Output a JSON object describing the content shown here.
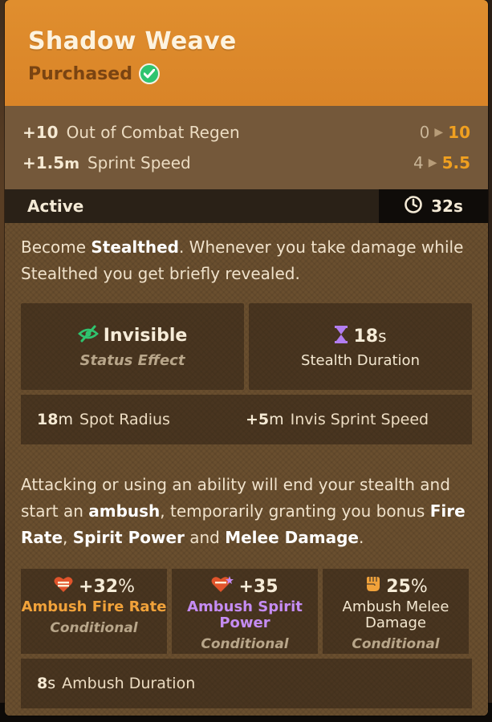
{
  "item": {
    "title": "Shadow Weave",
    "status": "Purchased",
    "accent_color": "#e08e2e"
  },
  "base_stats": [
    {
      "bonus": "+10",
      "unit": "",
      "label": "Out of Combat Regen",
      "from": "0",
      "to": "10"
    },
    {
      "bonus": "+1.5",
      "unit": "m",
      "label": "Sprint Speed",
      "from": "4",
      "to": "5.5"
    }
  ],
  "active": {
    "label": "Active",
    "cooldown": "32s",
    "cooldown_icon": "cooldown-clock-icon"
  },
  "description_1": {
    "p1": "Become ",
    "b1": "Stealthed",
    "p2": ". Whenever you take damage while Stealthed you get briefly revealed."
  },
  "effects": {
    "invisible": {
      "title": "Invisible",
      "sub": "Status Effect",
      "icon": "invisible-eye-icon",
      "color": "#2fc46f"
    },
    "stealth_duration": {
      "value": "18",
      "unit": "s",
      "label": "Stealth Duration",
      "icon": "hourglass-icon",
      "color": "#b27df0"
    },
    "spot_radius": {
      "value": "18",
      "unit": "m",
      "label": "Spot Radius"
    },
    "invis_sprint": {
      "value": "+5",
      "unit": "m",
      "label": "Invis Sprint Speed"
    }
  },
  "description_2": {
    "p1": "Attacking or using an ability will end your stealth and start an ",
    "b1": "ambush",
    "p2": ", temporarily granting you bonus ",
    "b2": "Fire Rate",
    "p3": ", ",
    "b3": "Spirit Power",
    "p4": " and ",
    "b4": "Melee Damage",
    "p5": "."
  },
  "ambush": [
    {
      "value": "+32",
      "unit": "%",
      "name": "Ambush Fire Rate",
      "cond": "Conditional",
      "icon": "fire-rate-icon"
    },
    {
      "value": "+35",
      "unit": "",
      "name": "Ambush Spirit Power",
      "cond": "Conditional",
      "icon": "spirit-power-icon"
    },
    {
      "value": "25",
      "unit": "%",
      "name": "Ambush Melee Damage",
      "cond": "Conditional",
      "icon": "melee-fist-icon"
    }
  ],
  "ambush_duration": {
    "value": "8",
    "unit": "s",
    "label": "Ambush Duration"
  }
}
